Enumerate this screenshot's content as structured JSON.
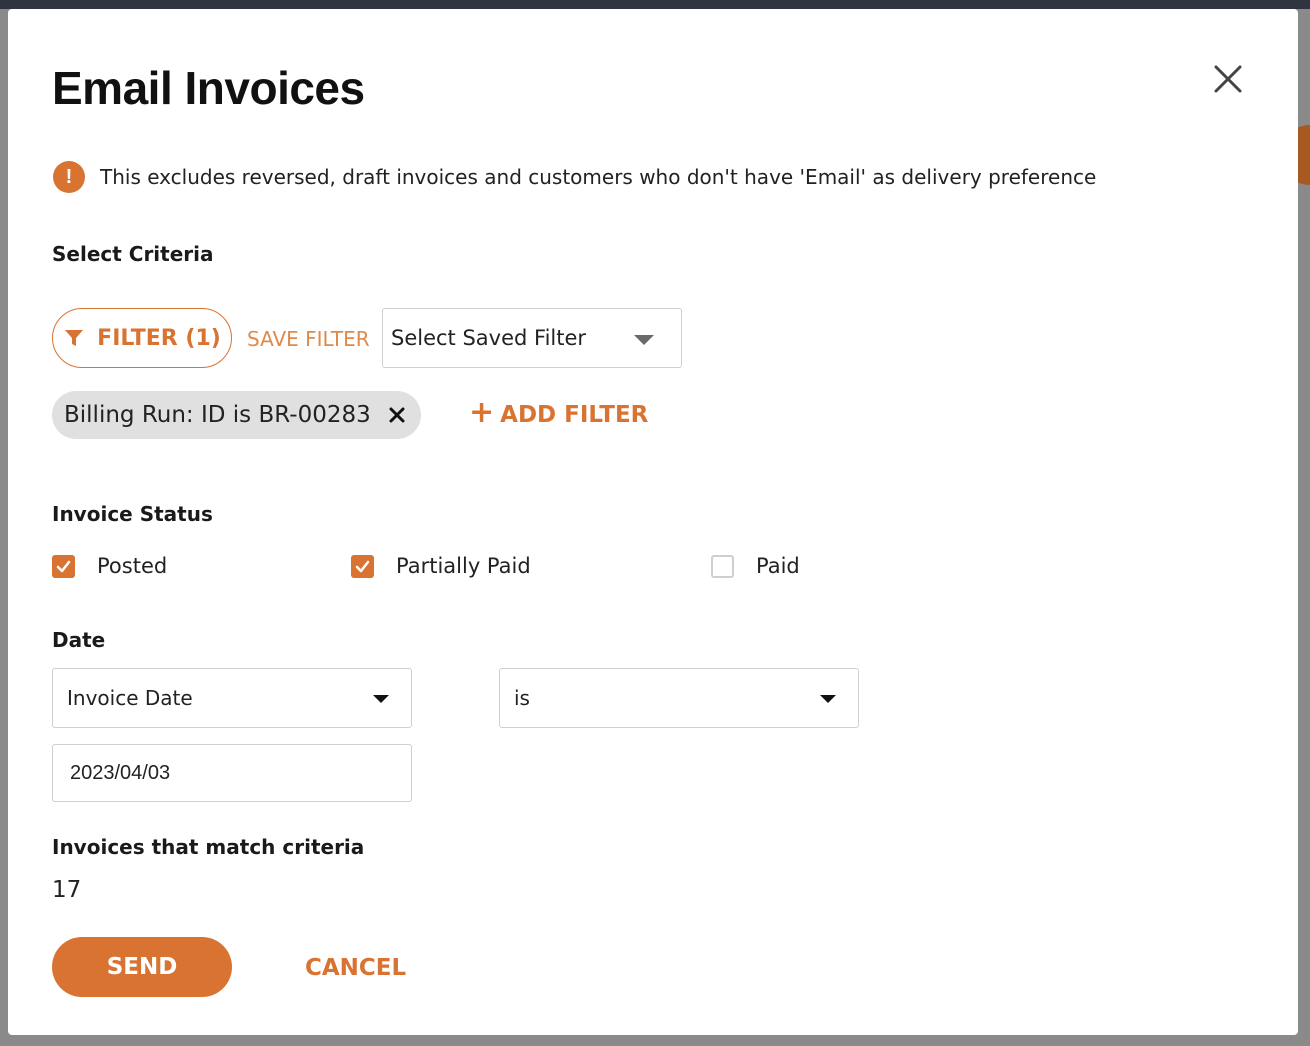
{
  "modal": {
    "title": "Email Invoices",
    "notice": "This excludes reversed, draft invoices and customers who don't have 'Email' as delivery preference",
    "select_criteria_label": "Select Criteria",
    "filter_button_label": "FILTER (1)",
    "save_filter_label": "SAVE FILTER",
    "saved_filter_select": "Select Saved Filter",
    "active_filter_chip": "Billing Run: ID is BR-00283",
    "add_filter_label": "ADD FILTER",
    "invoice_status_label": "Invoice Status",
    "statuses": [
      {
        "label": "Posted",
        "checked": true
      },
      {
        "label": "Partially Paid",
        "checked": true
      },
      {
        "label": "Paid",
        "checked": false
      }
    ],
    "date_label": "Date",
    "date_field_select": "Invoice Date",
    "date_operator_select": "is",
    "date_value": "2023/04/03",
    "match_label": "Invoices that match criteria",
    "match_count": "17",
    "send_label": "SEND",
    "cancel_label": "CANCEL"
  },
  "colors": {
    "accent": "#d97332",
    "chip_bg": "#e0e0e0",
    "border": "#cfcfcf"
  },
  "icons": {
    "close": "close-icon",
    "notice": "exclamation-circle-icon",
    "filter": "filter-funnel-icon",
    "chip_remove": "x-icon",
    "add": "plus-icon",
    "dropdown": "caret-down-icon"
  }
}
